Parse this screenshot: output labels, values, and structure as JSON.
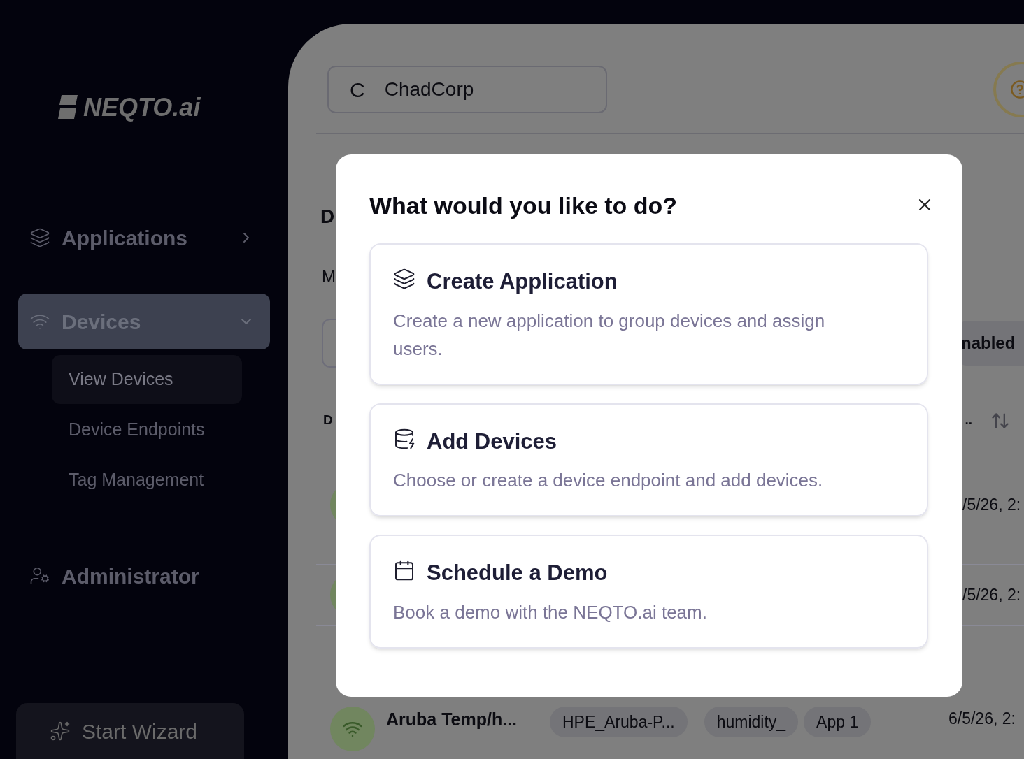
{
  "sidebar": {
    "logo": "NEQTO.ai",
    "items": [
      {
        "label": "Applications",
        "kind": "collapsed",
        "selected": false
      },
      {
        "label": "Devices",
        "kind": "expanded",
        "selected": true,
        "children": [
          {
            "label": "View Devices",
            "selected": true
          },
          {
            "label": "Device Endpoints",
            "selected": false
          },
          {
            "label": "Tag Management",
            "selected": false
          }
        ]
      },
      {
        "label": "Administrator",
        "kind": "plain",
        "selected": false
      }
    ],
    "wizard_button": "Start Wizard"
  },
  "header": {
    "org_initial": "C",
    "org_name": "ChadCorp"
  },
  "page": {
    "title": "D",
    "subtitle": "M",
    "filter_chip": "nabled",
    "table": {
      "columns": [
        "D",
        ".."
      ],
      "rows": [
        {
          "date": "/5/26, 2:"
        },
        {
          "date": "/5/26, 2:"
        },
        {
          "name": "Aruba Temp/h...",
          "endpoint": "HPE_Aruba-P...",
          "tags": [
            "humidity_",
            "App 1"
          ],
          "date": "6/5/26, 2:"
        }
      ]
    }
  },
  "dialog": {
    "title": "What would you like to do?",
    "options": [
      {
        "kind": "application",
        "title": "Create Application",
        "description": "Create a new application to group devices and assign users."
      },
      {
        "kind": "devices",
        "title": "Add Devices",
        "description": "Choose or create a device endpoint and add devices."
      },
      {
        "kind": "demo",
        "title": "Schedule a Demo",
        "description": "Book a demo with the NEQTO.ai team."
      }
    ]
  }
}
